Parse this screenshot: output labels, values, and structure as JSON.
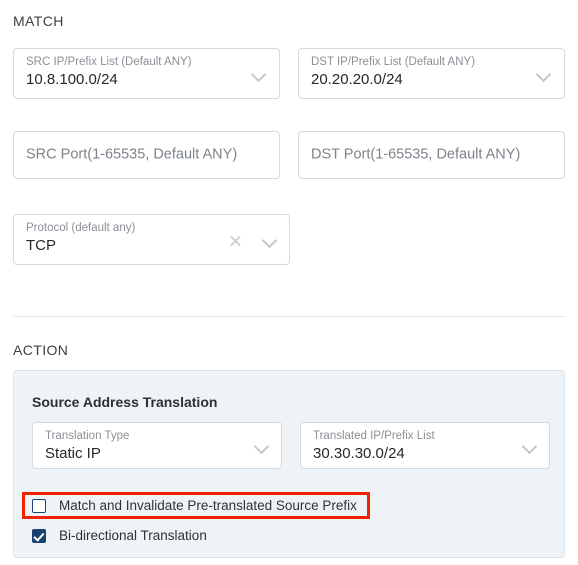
{
  "match": {
    "section_label": "MATCH",
    "fields": [
      {
        "label": "SRC IP/Prefix List (Default ANY)",
        "value": "10.8.100.0/24"
      },
      {
        "label": "DST IP/Prefix List (Default ANY)",
        "value": "20.20.20.0/24"
      },
      {
        "placeholder": "SRC Port(1-65535, Default ANY)",
        "value": ""
      },
      {
        "placeholder": "DST Port(1-65535, Default ANY)",
        "value": ""
      },
      {
        "label": "Protocol (default any)",
        "value": "TCP"
      }
    ]
  },
  "action": {
    "section_label": "ACTION",
    "panel": {
      "title": "Source Address Translation",
      "fields": [
        {
          "label": "Translation Type",
          "value": "Static IP"
        },
        {
          "label": "Translated IP/Prefix List",
          "value": "30.30.30.0/24"
        }
      ],
      "checkboxes": [
        {
          "label": "Match and Invalidate Pre-translated Source Prefix",
          "checked": false,
          "highlighted": true
        },
        {
          "label": "Bi-directional Translation",
          "checked": true,
          "highlighted": false
        }
      ]
    }
  },
  "icons": {
    "chevron_down": "chevron-down-icon",
    "clear": "clear-icon"
  },
  "colors": {
    "panel_background": "#eef3f8",
    "panel_border": "#dbe3eb",
    "checkbox_accent": "#1b4172",
    "highlight_outline": "#f02200",
    "field_border": "#d6dadd",
    "label_text": "#8b9096",
    "value_text": "#23282d"
  }
}
